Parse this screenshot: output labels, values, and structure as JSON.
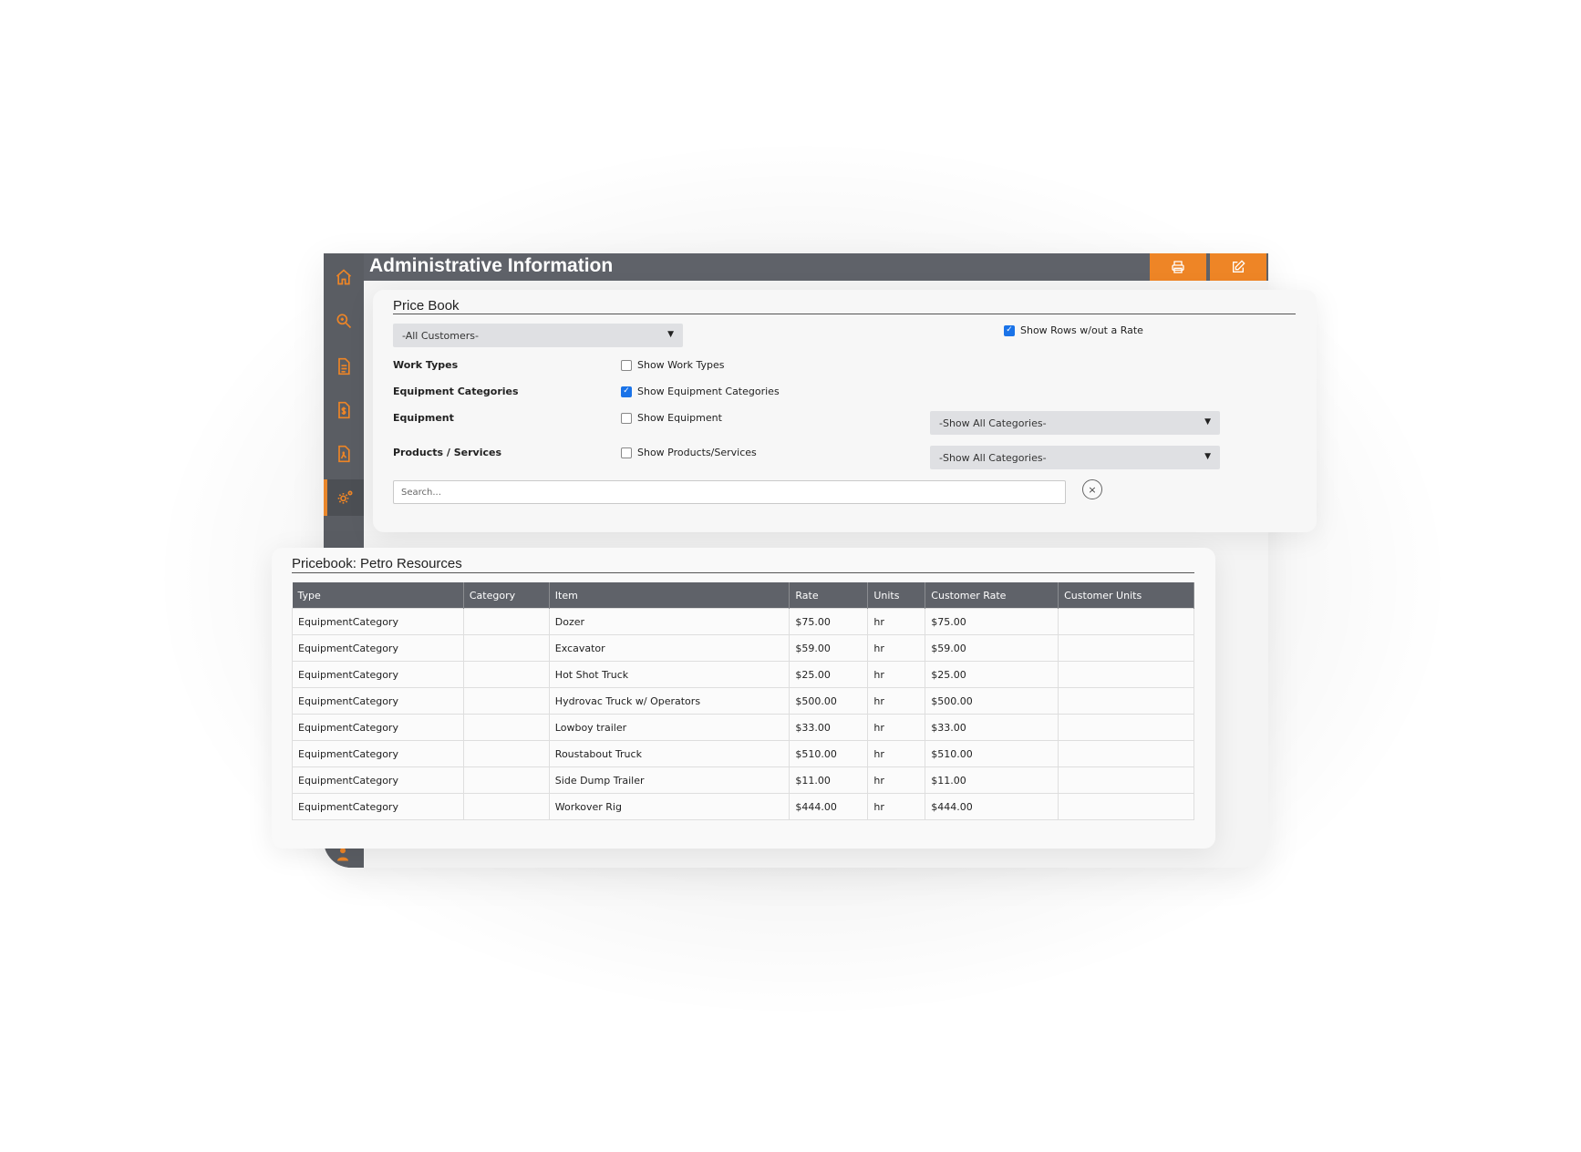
{
  "header": {
    "title": "Administrative Information",
    "print_icon": "print-icon",
    "edit_icon": "edit-icon"
  },
  "sidebar": {
    "items": [
      {
        "icon": "home-icon"
      },
      {
        "icon": "search-icon"
      },
      {
        "icon": "document-icon"
      },
      {
        "icon": "invoice-icon"
      },
      {
        "icon": "pdf-icon"
      },
      {
        "icon": "settings-icon",
        "active": true
      }
    ],
    "bottom_icon": "user-icon"
  },
  "filters": {
    "section_title": "Price Book",
    "customer_select": "-All Customers-",
    "show_rows_without_rate": {
      "label": "Show Rows w/out a Rate",
      "checked": true
    },
    "rows": [
      {
        "label": "Work Types",
        "checkbox_label": "Show Work Types",
        "checked": false
      },
      {
        "label": "Equipment Categories",
        "checkbox_label": "Show Equipment Categories",
        "checked": true
      },
      {
        "label": "Equipment",
        "checkbox_label": "Show Equipment",
        "checked": false,
        "select": "-Show All Categories-"
      },
      {
        "label": "Products / Services",
        "checkbox_label": "Show Products/Services",
        "checked": false,
        "select": "-Show All Categories-"
      }
    ],
    "search_placeholder": "Search...",
    "clear_label": "×"
  },
  "pricebook": {
    "title": "Pricebook: Petro Resources",
    "columns": [
      "Type",
      "Category",
      "Item",
      "Rate",
      "Units",
      "Customer Rate",
      "Customer Units"
    ],
    "rows": [
      [
        "EquipmentCategory",
        "",
        "Dozer",
        "$75.00",
        "hr",
        "$75.00",
        ""
      ],
      [
        "EquipmentCategory",
        "",
        "Excavator",
        "$59.00",
        "hr",
        "$59.00",
        ""
      ],
      [
        "EquipmentCategory",
        "",
        "Hot Shot Truck",
        "$25.00",
        "hr",
        "$25.00",
        ""
      ],
      [
        "EquipmentCategory",
        "",
        "Hydrovac Truck w/ Operators",
        "$500.00",
        "hr",
        "$500.00",
        ""
      ],
      [
        "EquipmentCategory",
        "",
        "Lowboy trailer",
        "$33.00",
        "hr",
        "$33.00",
        ""
      ],
      [
        "EquipmentCategory",
        "",
        "Roustabout Truck",
        "$510.00",
        "hr",
        "$510.00",
        ""
      ],
      [
        "EquipmentCategory",
        "",
        "Side Dump Trailer",
        "$11.00",
        "hr",
        "$11.00",
        ""
      ],
      [
        "EquipmentCategory",
        "",
        "Workover Rig",
        "$444.00",
        "hr",
        "$444.00",
        ""
      ]
    ]
  },
  "colors": {
    "accent": "#ee8526",
    "header_bg": "#5f6269",
    "checkbox_checked": "#1a73e8"
  }
}
